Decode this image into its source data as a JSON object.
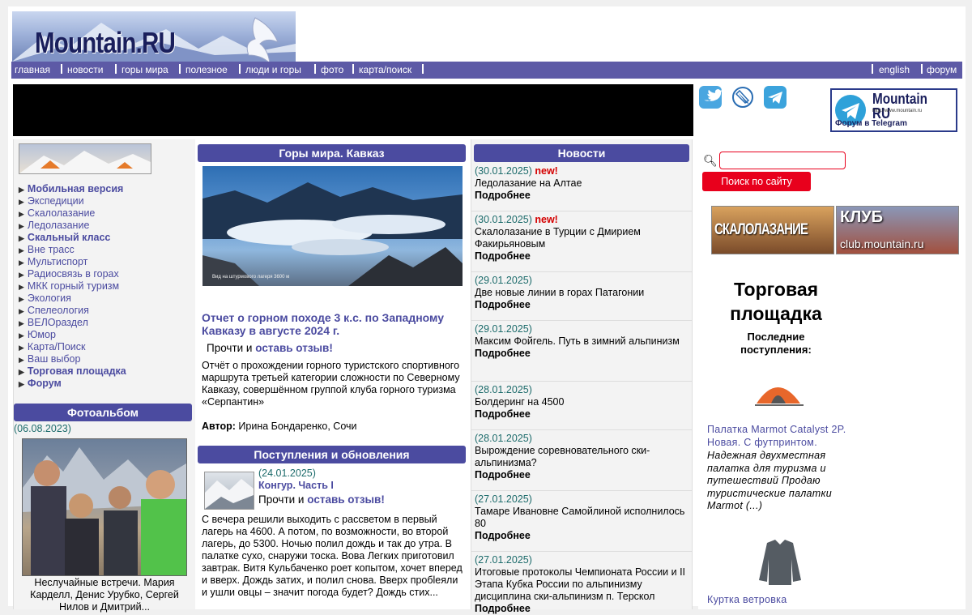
{
  "site": {
    "logo": "Mountain.RU"
  },
  "nav": {
    "left": [
      "главная",
      "новости",
      "горы мира",
      "полезное",
      "люди и горы",
      "фото",
      "карта/поиск"
    ],
    "right": [
      "english",
      "форум"
    ]
  },
  "telegram_banner": {
    "title": "Mountain RU",
    "subtitle": "Форум в Telegram",
    "url": "http://www.mountain.ru"
  },
  "social_icons": [
    "twitter-icon",
    "livejournal-icon",
    "telegram-icon"
  ],
  "sidebar": {
    "items": [
      {
        "label": "Мобильная версия",
        "bold": true
      },
      {
        "label": "Экспедиции",
        "bold": false
      },
      {
        "label": "Скалолазание",
        "bold": false
      },
      {
        "label": "Ледолазание",
        "bold": false
      },
      {
        "label": "Скальный класс",
        "bold": true
      },
      {
        "label": "Вне трасс",
        "bold": false
      },
      {
        "label": "Мультиспорт",
        "bold": false
      },
      {
        "label": "Радиосвязь в горах",
        "bold": false
      },
      {
        "label": "МКК горный туризм",
        "bold": false
      },
      {
        "label": "Экология",
        "bold": false
      },
      {
        "label": "Спелеология",
        "bold": false
      },
      {
        "label": "ВЕЛОраздел",
        "bold": false
      },
      {
        "label": "Юмор",
        "bold": false
      },
      {
        "label": "Карта/Поиск",
        "bold": false
      },
      {
        "label": "Ваш выбор",
        "bold": false
      },
      {
        "label": "Торговая площадка",
        "bold": true
      },
      {
        "label": "Форум",
        "bold": true
      }
    ],
    "photoalbum": {
      "title": "Фотоальбом",
      "date": "(06.08.2023)",
      "caption": "Неслучайные встречи. Мария Карделл, Денис Урубко, Сергей Нилов и Дмитрий..."
    }
  },
  "main": {
    "section_title": "Горы мира. Кавказ",
    "photo_caption": "Вид на штурмового лагеря 3600 м",
    "article_title": "Отчет о горном походе 3 к.с. по Западному Кавказу в августе 2024 г.",
    "read_prefix": "Прочти и",
    "review_link": "оставь отзыв!",
    "article_text": "Отчёт о прохождении горного туристского спортивного маршрута третьей категории сложности по Северному Кавказу, совершённом группой клуба горного туризма «Серпантин»",
    "author_label": "Автор:",
    "author": "Ирина Бондаренко, Сочи",
    "updates_title": "Поступления и обновления",
    "update": {
      "date": "(24.01.2025)",
      "title": "Конгур. Часть I",
      "text": "С вечера решили выходить с рассветом в первый лагерь на 4600. А потом, по возможности, во второй лагерь, до 5300. Ночью полил дождь и так до утра. В палатке сухо, снаружи тоска. Вова Легких приготовил завтрак. Витя Кульбаченко роет копытом, хочет вперед и вверх. Дождь затих, и полил снова. Вверх пробleяли и ушли овцы – значит погода будет? Дождь стих..."
    }
  },
  "news": {
    "title": "Новости",
    "new_label": "new!",
    "more_label": "Подробнее",
    "items": [
      {
        "date": "(30.01.2025)",
        "new": true,
        "title": "Ледолазание на Алтае"
      },
      {
        "date": "(30.01.2025)",
        "new": true,
        "title": "Скалолазание в Турции с Дмирием Факирьяновым"
      },
      {
        "date": "(29.01.2025)",
        "new": false,
        "title": "Две новые линии в горах Патагонии"
      },
      {
        "date": "(29.01.2025)",
        "new": false,
        "title": "Максим Фойгель. Путь в зимний альпинизм"
      },
      {
        "date": "(28.01.2025)",
        "new": false,
        "title": "Болдеринг на 4500"
      },
      {
        "date": "(28.01.2025)",
        "new": false,
        "title": "Вырождение соревновательного ски-альпинизма?"
      },
      {
        "date": "(27.01.2025)",
        "new": false,
        "title": "Тамаре Ивановне Самойлиной исполнилось 80"
      },
      {
        "date": "(27.01.2025)",
        "new": false,
        "title": "Итоговые протоколы Чемпионата России и II Этапа Кубка России по альпинизму дисциплина ски-альпинизм п. Терскол"
      }
    ]
  },
  "right": {
    "search_placeholder": "",
    "search_button": "Поиск по сайту",
    "banner_climbing": "СКАЛОЛАЗАНИЕ",
    "banner_club_top": "КЛУБ",
    "banner_club_bottom": "club.mountain.ru",
    "market_title": "Торговая площадка",
    "market_sub": "Последние поступления:",
    "product1_title": "Палатка Marmot Catalyst 2P. Новая. С футпринтом.",
    "product1_desc": "Надежная двухместная палатка для туризма и путешествий Продаю туристические палатки Marmot (...)",
    "product2_title": "Куртка ветровка"
  },
  "colors": {
    "nav": "#5d5aa6",
    "section": "#4b4ba0",
    "new": "#d40000",
    "date": "#1c6b6b",
    "search_btn": "#e8001c"
  }
}
